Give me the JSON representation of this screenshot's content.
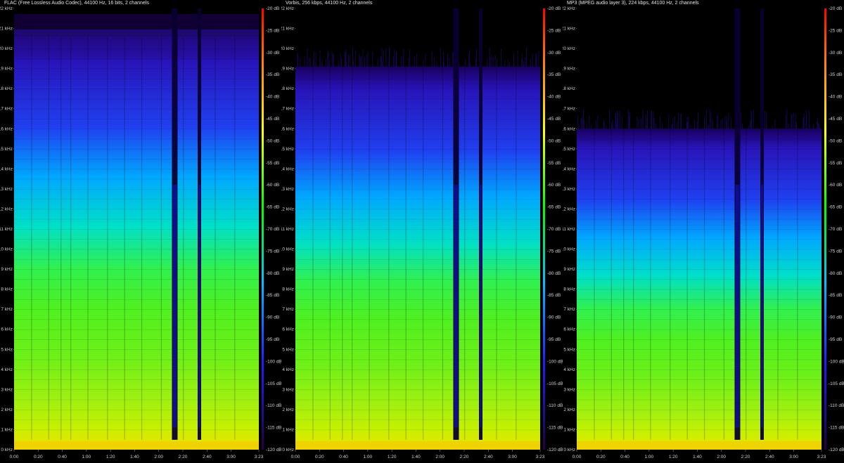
{
  "panels": [
    {
      "id": "flac",
      "title": "FLAC (Free Lossless Audio Codec), 44100 Hz, 16 bits, 2 channels",
      "cutoff_khz": 20.6
    },
    {
      "id": "vorbis",
      "title": "Vorbis, 256 kbps, 44100 Hz, 2 channels",
      "cutoff_khz": 19.1
    },
    {
      "id": "mp3",
      "title": "MP3 (MPEG audio layer 3), 224 kbps, 44100 Hz, 2 channels",
      "cutoff_khz": 16.0
    }
  ],
  "freq_ticks": [
    "0 kHz",
    "1 kHz",
    "2 kHz",
    "3 kHz",
    "4 kHz",
    "5 kHz",
    "6 kHz",
    "7 kHz",
    "8 kHz",
    "9 kHz",
    "10 kHz",
    "11 kHz",
    "12 kHz",
    "13 kHz",
    "14 kHz",
    "15 kHz",
    "16 kHz",
    "17 kHz",
    "18 kHz",
    "19 kHz",
    "20 kHz",
    "21 kHz",
    "22 kHz"
  ],
  "time_ticks": [
    "0:00",
    "0:20",
    "0:40",
    "1:00",
    "1:20",
    "1:40",
    "2:00",
    "2:20",
    "2:40",
    "3:00",
    "3:23"
  ],
  "db_ticks": [
    "-20 dB",
    "-25 dB",
    "-30 dB",
    "-35 dB",
    "-40 dB",
    "-45 dB",
    "-50 dB",
    "-55 dB",
    "-60 dB",
    "-65 dB",
    "-70 dB",
    "-75 dB",
    "-80 dB",
    "-85 dB",
    "-90 dB",
    "-95 dB",
    "-100 dB",
    "-105 dB",
    "-110 dB",
    "-115 dB",
    "-120 dB"
  ],
  "duration_seconds": 203,
  "max_freq_khz": 22,
  "colors": {
    "background": "#000000",
    "text": "#d0d0d0",
    "colormap": [
      "#000000",
      "#1a0040",
      "#2a10a0",
      "#2040ff",
      "#00a0ff",
      "#00e0c0",
      "#40ff20",
      "#b0ff00",
      "#ffff00",
      "#ff8000",
      "#ff0000"
    ]
  }
}
